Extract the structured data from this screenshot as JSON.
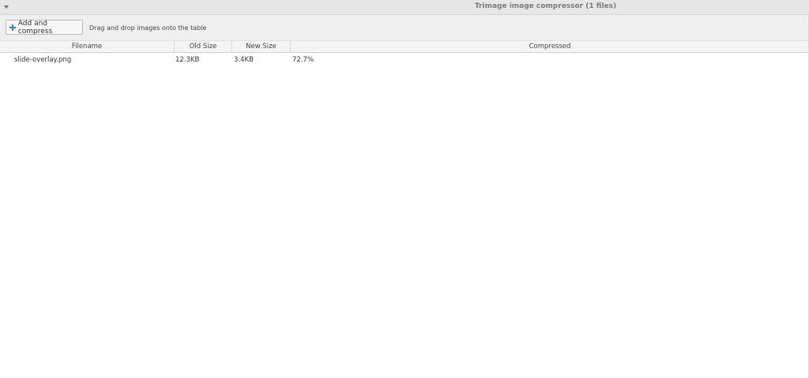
{
  "window": {
    "title": "Trimage image compressor (1 files)"
  },
  "toolbar": {
    "add_button_label": "Add and compress",
    "add_button_icon": "plus-icon",
    "hint": "Drag and drop images onto the table"
  },
  "table": {
    "columns": [
      "Filename",
      "Old Size",
      "New Size",
      "Compressed"
    ],
    "rows": [
      {
        "filename": "slide-overlay.png",
        "old_size": "12.3KB",
        "new_size": "3.4KB",
        "compressed": "72.7%"
      }
    ]
  },
  "colors": {
    "accent": "#3e7fc1",
    "titlebar": "#e7e7e7",
    "toolbar": "#efefef"
  }
}
